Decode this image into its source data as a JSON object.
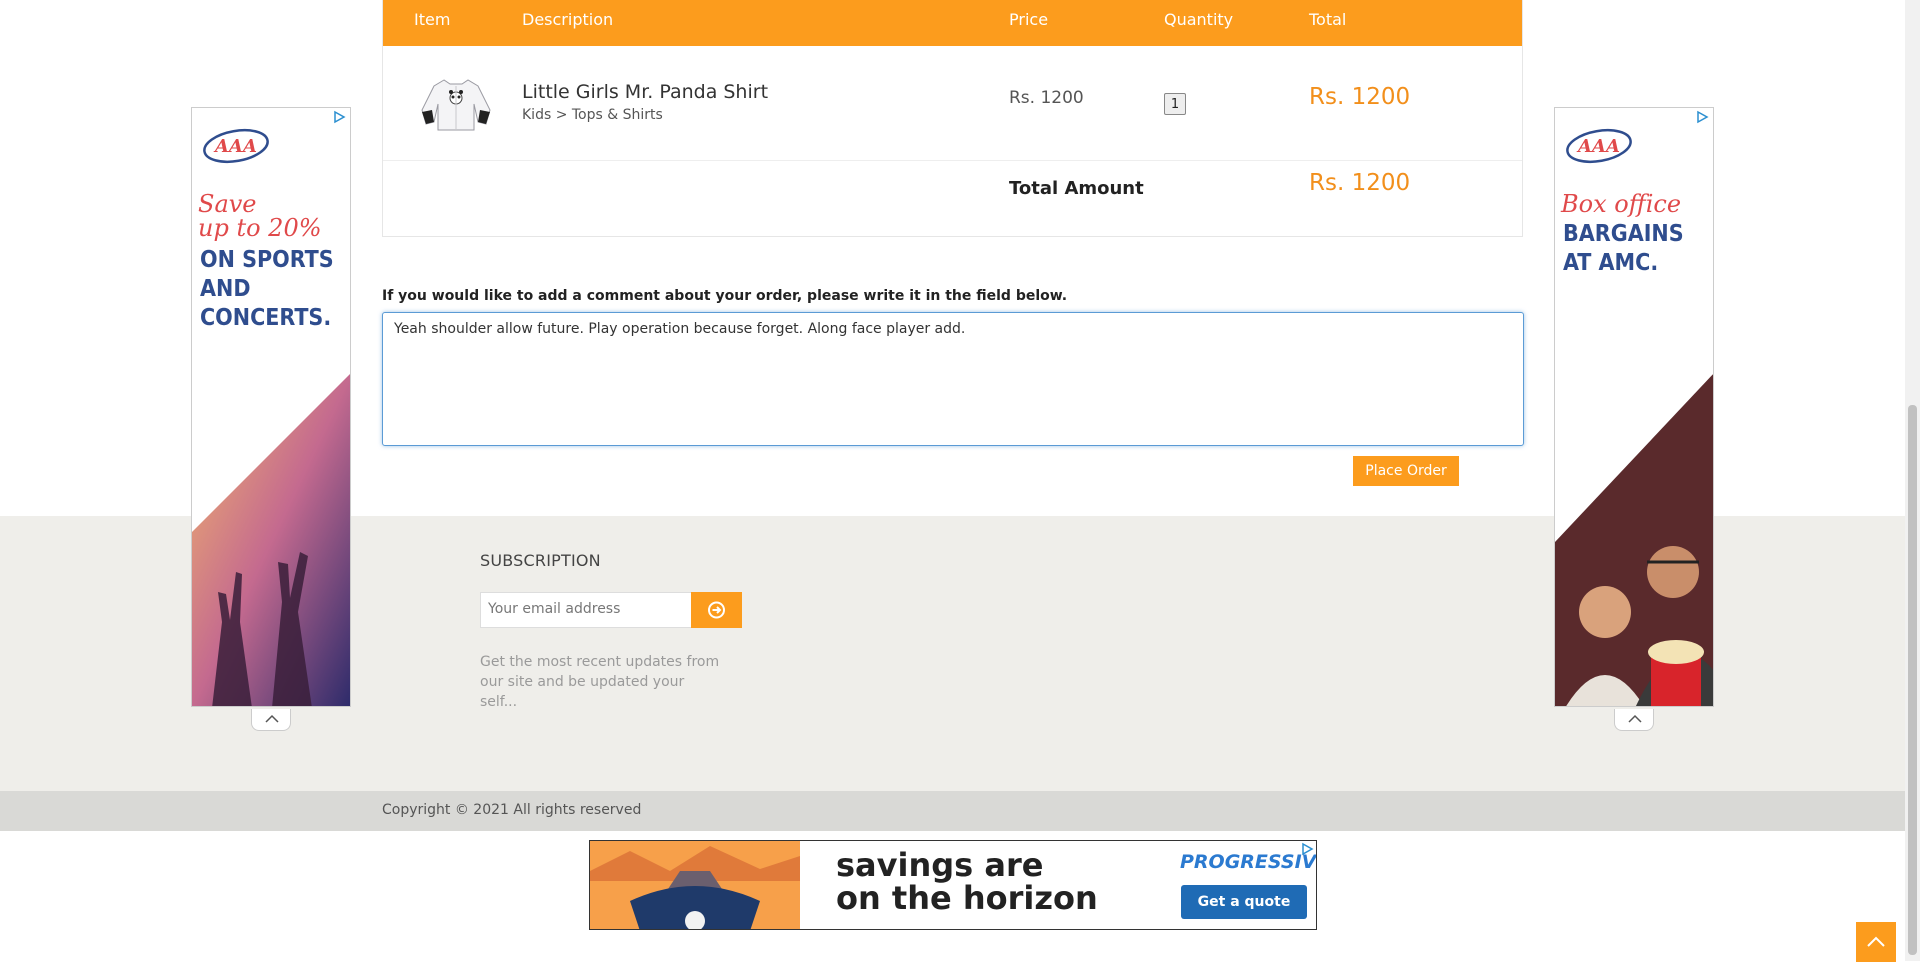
{
  "cart": {
    "headers": {
      "item": "Item",
      "description": "Description",
      "price": "Price",
      "quantity": "Quantity",
      "total": "Total"
    },
    "product": {
      "name": "Little Girls Mr. Panda Shirt",
      "category": "Kids > Tops & Shirts",
      "price": "Rs. 1200",
      "quantity": "1",
      "total": "Rs. 1200"
    },
    "total_label": "Total Amount",
    "total_value": "Rs. 1200"
  },
  "comment": {
    "label": "If you would like to add a comment about your order, please write it in the field below.",
    "value": "Yeah shoulder allow future. Play operation because forget. Along face player add."
  },
  "place_order_label": "Place Order",
  "subscription": {
    "title": "SUBSCRIPTION",
    "placeholder": "Your email address",
    "description": "Get the most recent updates from our site and be updated your self..."
  },
  "copyright": "Copyright © 2021 All rights reserved",
  "ads": {
    "left": {
      "brand": "AAA",
      "script_lines": [
        "Save",
        "up to 20%"
      ],
      "bold_lines": [
        "ON SPORTS",
        "AND",
        "CONCERTS."
      ]
    },
    "right": {
      "brand": "AAA",
      "script_lines": [
        "Box office"
      ],
      "bold_lines": [
        "BARGAINS",
        "AT AMC."
      ]
    },
    "bottom": {
      "headline_1": "savings are",
      "headline_2": "on the horizon",
      "brand": "PROGRESSIVE",
      "cta": "Get a quote"
    }
  },
  "colors": {
    "accent": "#fc9c1d",
    "price_orange": "#f28f1b",
    "footer_bg": "#efeeea"
  },
  "icons": [
    "ad-choices-icon",
    "arrow-right-circle-icon",
    "chevron-up-icon",
    "scroll-to-top-icon"
  ]
}
